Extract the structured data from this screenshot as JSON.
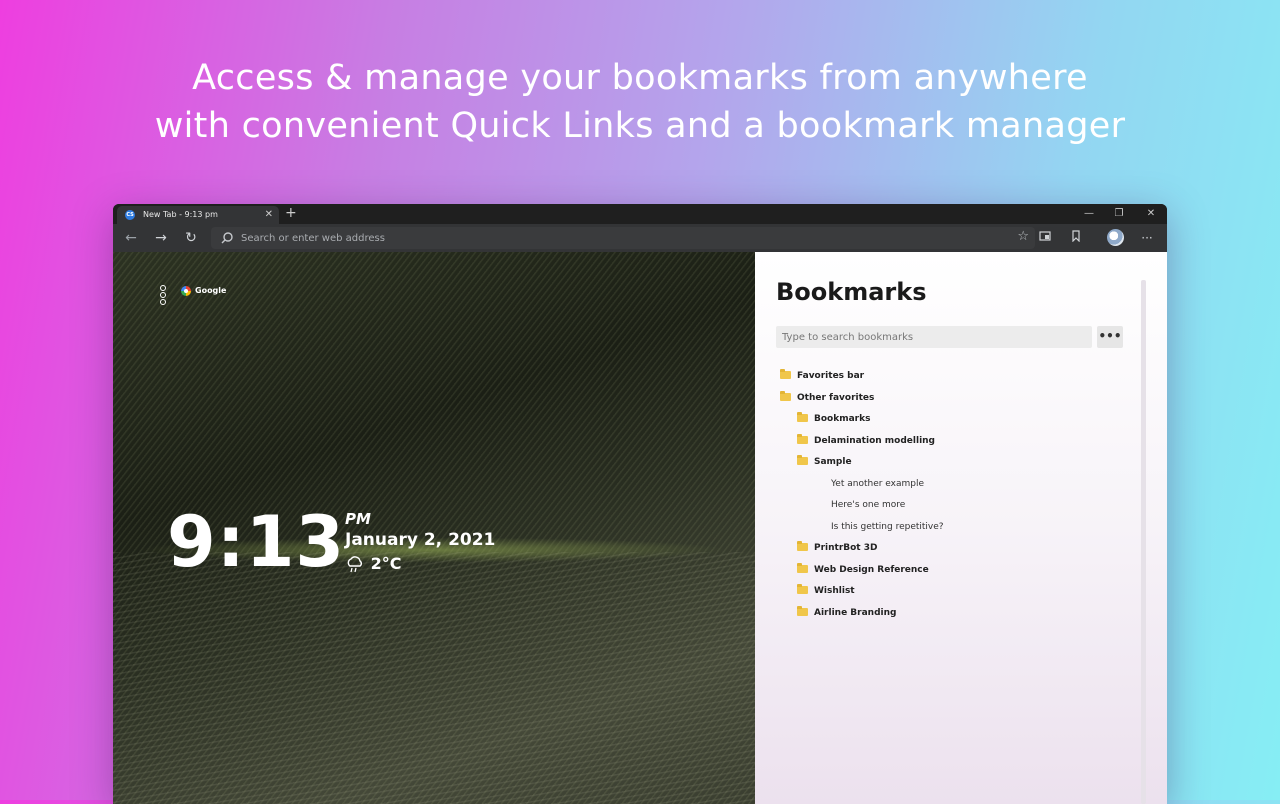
{
  "headline": {
    "line1": "Access & manage your bookmarks from anywhere",
    "line2": "with convenient Quick Links and a bookmark manager"
  },
  "browser": {
    "tab": {
      "favicon": "CS",
      "title": "New Tab - 9:13 pm"
    },
    "address_placeholder": "Search or enter web address",
    "icons": [
      "back-icon",
      "forward-icon",
      "refresh-icon",
      "search-icon",
      "star-icon",
      "collections-icon",
      "favorites-icon",
      "profile-avatar",
      "more-icon"
    ]
  },
  "newtab": {
    "quick_link": "Google",
    "clock": {
      "time": "9:13",
      "ampm": "PM",
      "date": "January 2, 2021",
      "temperature": "2°C",
      "weather_icon": "rain-cloud-icon"
    }
  },
  "bookmarks": {
    "title": "Bookmarks",
    "search_placeholder": "Type to search bookmarks",
    "more_label": "•••",
    "items": [
      {
        "label": "Favorites bar",
        "type": "folder",
        "depth": 0
      },
      {
        "label": "Other favorites",
        "type": "folder",
        "depth": 0
      },
      {
        "label": "Bookmarks",
        "type": "folder",
        "depth": 1
      },
      {
        "label": "Delamination modelling",
        "type": "folder",
        "depth": 1
      },
      {
        "label": "Sample",
        "type": "folder",
        "depth": 1
      },
      {
        "label": "Yet another example",
        "type": "link",
        "depth": 2
      },
      {
        "label": "Here's one more",
        "type": "link",
        "depth": 2
      },
      {
        "label": "Is this getting repetitive?",
        "type": "link",
        "depth": 2
      },
      {
        "label": "PrintrBot 3D",
        "type": "folder",
        "depth": 1
      },
      {
        "label": "Web Design Reference",
        "type": "folder",
        "depth": 1
      },
      {
        "label": "Wishlist",
        "type": "folder",
        "depth": 1
      },
      {
        "label": "Airline Branding",
        "type": "folder",
        "depth": 1
      }
    ]
  }
}
